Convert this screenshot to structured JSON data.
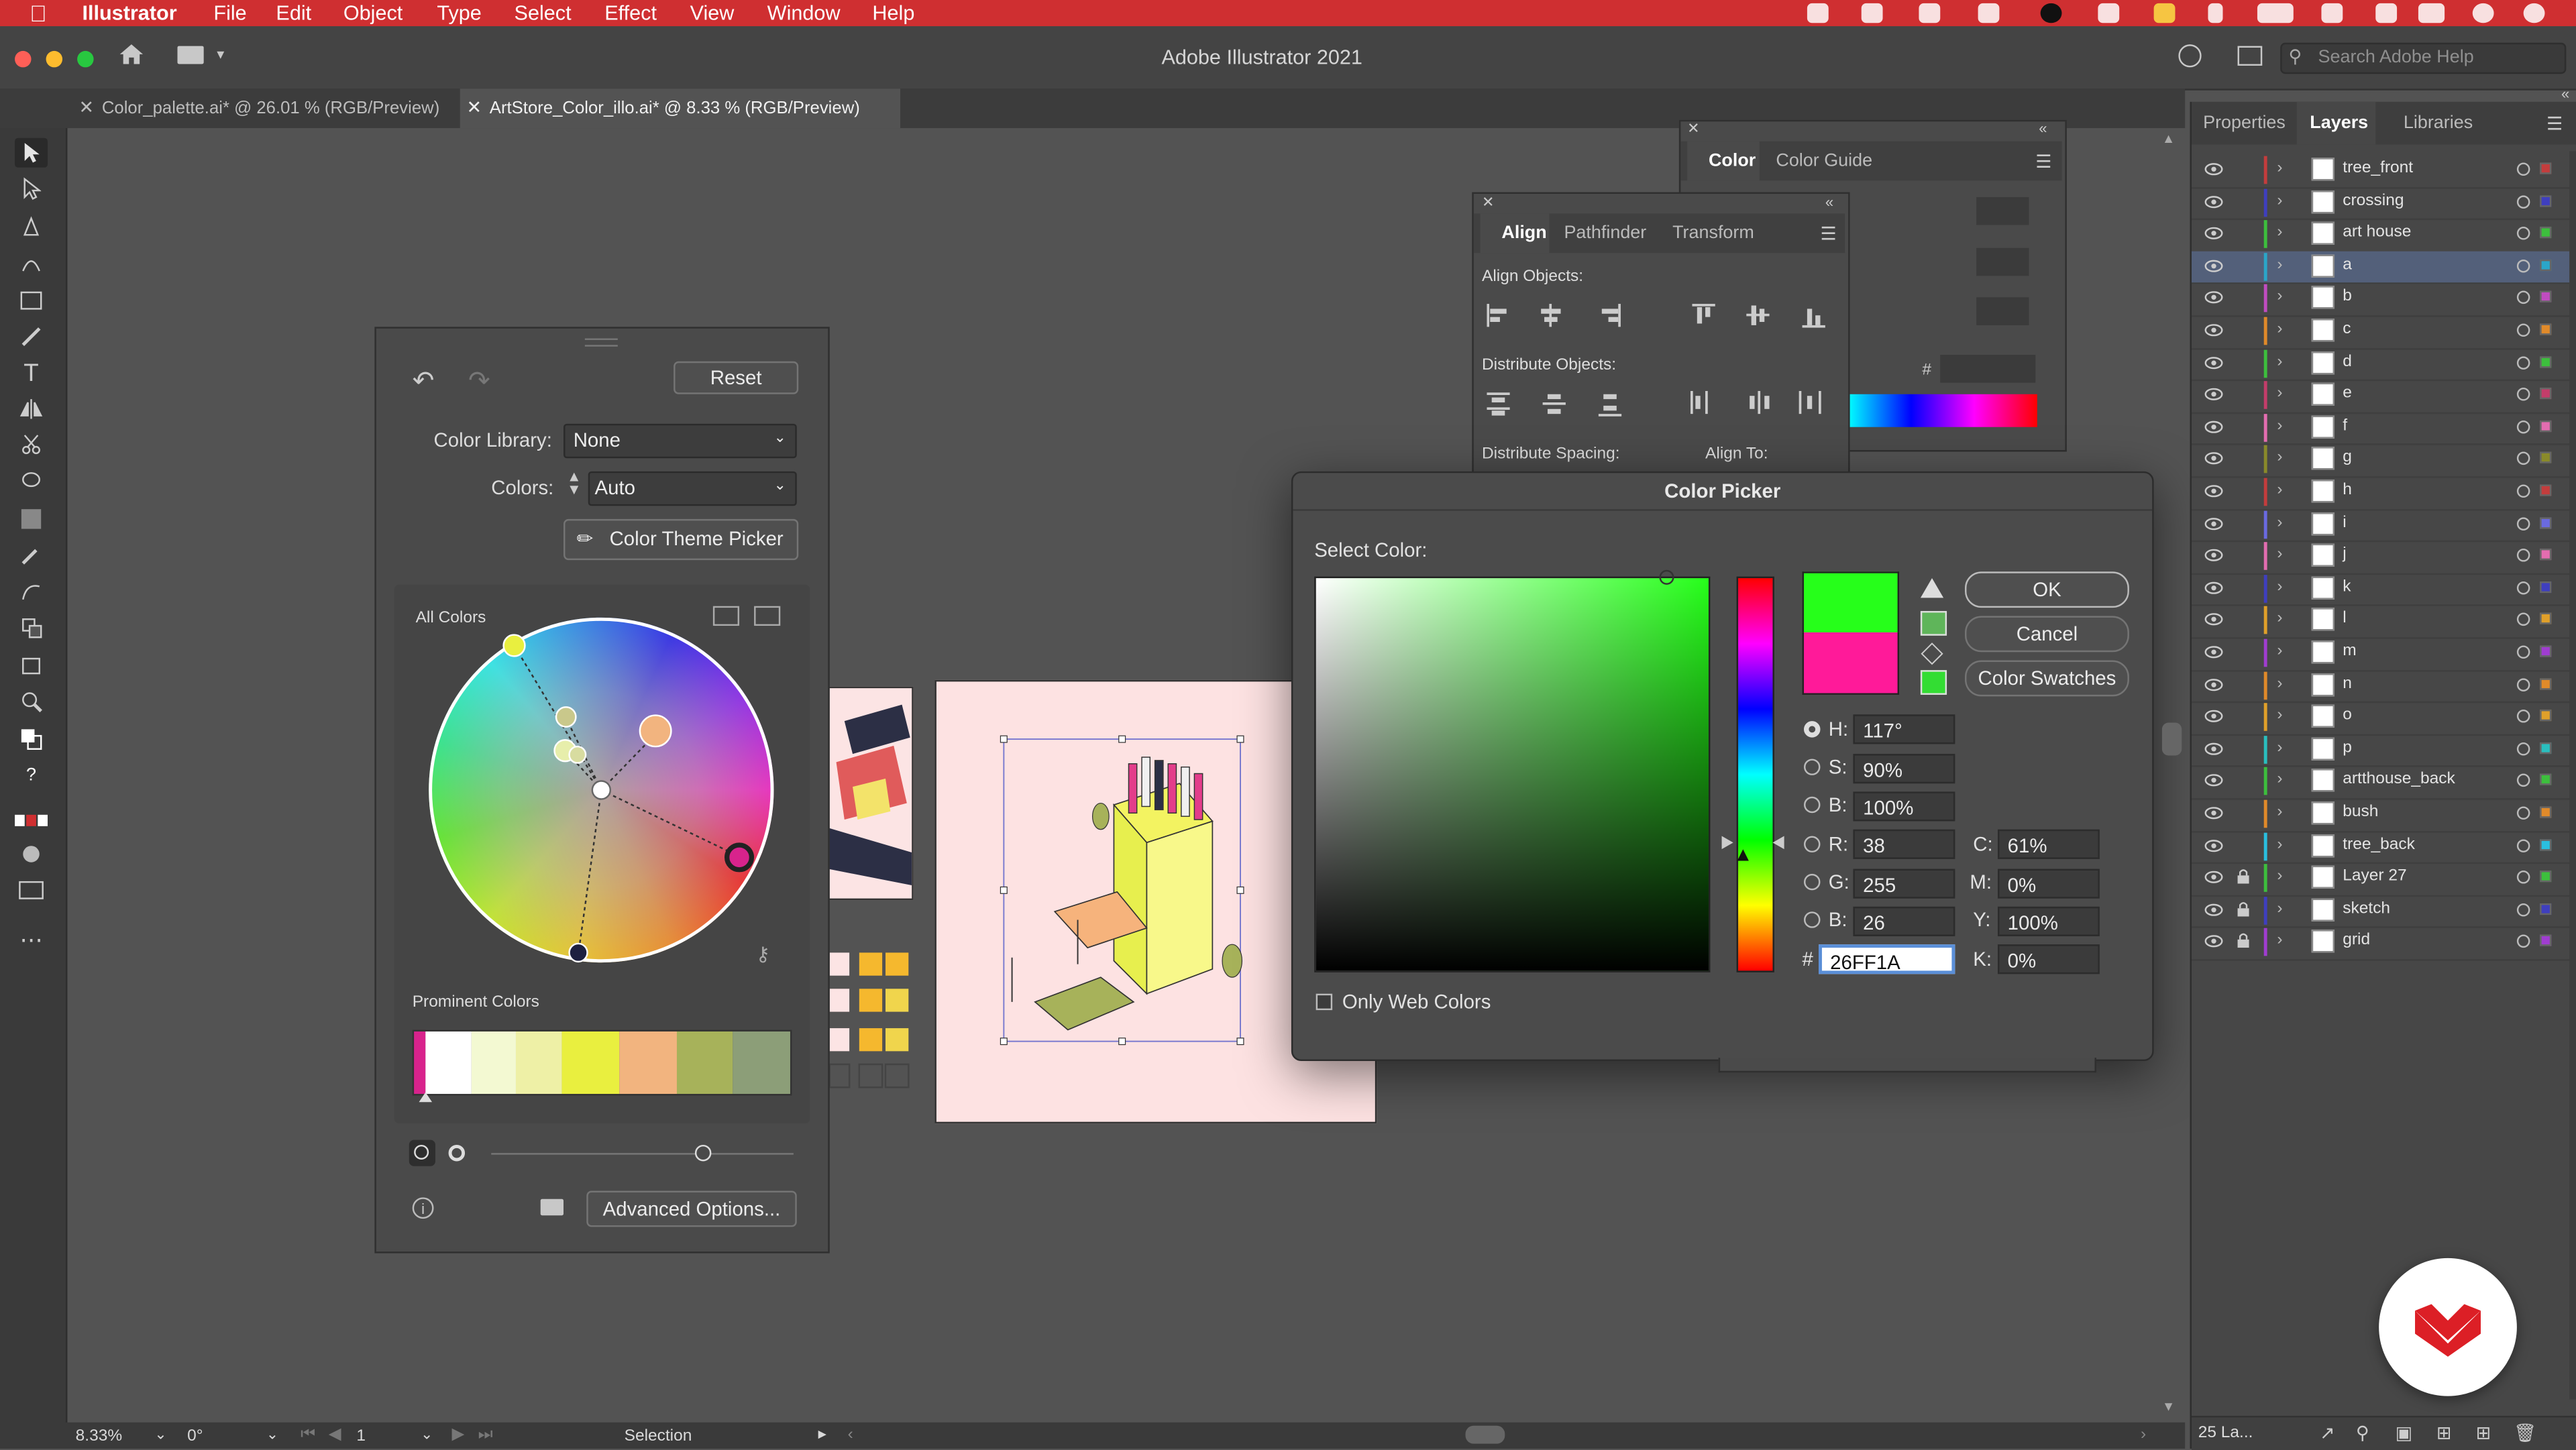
{
  "menubar": {
    "app": "Illustrator",
    "items": [
      "File",
      "Edit",
      "Object",
      "Type",
      "Select",
      "Effect",
      "View",
      "Window",
      "Help"
    ]
  },
  "window": {
    "title": "Adobe Illustrator 2021",
    "search_placeholder": "Search Adobe Help"
  },
  "tabs": [
    {
      "label": "Color_palette.ai* @ 26.01 % (RGB/Preview)",
      "active": false
    },
    {
      "label": "ArtStore_Color_illo.ai* @ 8.33 % (RGB/Preview)",
      "active": true
    }
  ],
  "recolor": {
    "reset": "Reset",
    "color_library_label": "Color Library:",
    "color_library_value": "None",
    "colors_label": "Colors:",
    "colors_value": "Auto",
    "theme_picker": "Color Theme Picker",
    "all_colors": "All Colors",
    "prominent_colors": "Prominent Colors",
    "advanced_options": "Advanced Options...",
    "prominent_swatches": [
      "#d8238c",
      "#ffffff",
      "#f3f9d2",
      "#eef0a6",
      "#e9ef3f",
      "#f2b47f",
      "#a7b25a",
      "#8c9e78"
    ]
  },
  "color_panel": {
    "tabs": [
      "Color",
      "Color Guide"
    ],
    "hash": "#"
  },
  "align_panel": {
    "tabs": [
      "Align",
      "Pathfinder",
      "Transform"
    ],
    "align_objects": "Align Objects:",
    "distribute_objects": "Distribute Objects:",
    "distribute_spacing": "Distribute Spacing:",
    "align_to": "Align To:"
  },
  "color_picker": {
    "title": "Color Picker",
    "select_color": "Select Color:",
    "ok": "OK",
    "cancel": "Cancel",
    "swatches": "Color Swatches",
    "only_web": "Only Web Colors",
    "new_color": "#26ff1a",
    "old_color": "#ff1a99",
    "fields": {
      "H": "117°",
      "S": "90%",
      "B": "100%",
      "R": "38",
      "G": "255",
      "B2": "26",
      "hex": "26FF1A",
      "C": "61%",
      "M": "0%",
      "Y": "100%",
      "K": "0%"
    },
    "field_labels": {
      "H": "H:",
      "S": "S:",
      "B": "B:",
      "R": "R:",
      "G": "G:",
      "B2": "B:",
      "C": "C:",
      "M": "M:",
      "Y": "Y:",
      "K": "K:",
      "hash": "#"
    }
  },
  "layers_panel": {
    "tabs": [
      "Properties",
      "Layers",
      "Libraries"
    ],
    "footer_count": "25 La...",
    "layers": [
      {
        "name": "tree_front",
        "color": "#c33d3d",
        "locked": false
      },
      {
        "name": "crossing",
        "color": "#3f3fbf",
        "locked": false
      },
      {
        "name": "art house",
        "color": "#3dbf3d",
        "locked": false
      },
      {
        "name": "a",
        "color": "#2aa6c8",
        "locked": false,
        "selected": true
      },
      {
        "name": "b",
        "color": "#c04cc0",
        "locked": false
      },
      {
        "name": "c",
        "color": "#e08a2a",
        "locked": false
      },
      {
        "name": "d",
        "color": "#3dbf3d",
        "locked": false
      },
      {
        "name": "e",
        "color": "#c33d6a",
        "locked": false
      },
      {
        "name": "f",
        "color": "#e36db0",
        "locked": false
      },
      {
        "name": "g",
        "color": "#8a8a2a",
        "locked": false
      },
      {
        "name": "h",
        "color": "#c33d3d",
        "locked": false
      },
      {
        "name": "i",
        "color": "#6a6ae0",
        "locked": false
      },
      {
        "name": "j",
        "color": "#e36db0",
        "locked": false
      },
      {
        "name": "k",
        "color": "#3f3fbf",
        "locked": false
      },
      {
        "name": "l",
        "color": "#e0a02a",
        "locked": false
      },
      {
        "name": "m",
        "color": "#a03dd0",
        "locked": false
      },
      {
        "name": "n",
        "color": "#e08a2a",
        "locked": false
      },
      {
        "name": "o",
        "color": "#e0a02a",
        "locked": false
      },
      {
        "name": "p",
        "color": "#2abfbf",
        "locked": false
      },
      {
        "name": "artthouse_back",
        "color": "#3dbf3d",
        "locked": false
      },
      {
        "name": "bush",
        "color": "#e08a2a",
        "locked": false
      },
      {
        "name": "tree_back",
        "color": "#2abfdf",
        "locked": false
      },
      {
        "name": "Layer 27",
        "color": "#3dbf3d",
        "locked": true
      },
      {
        "name": "sketch",
        "color": "#3f3fbf",
        "locked": true
      },
      {
        "name": "grid",
        "color": "#a03dd0",
        "locked": true
      }
    ]
  },
  "status": {
    "zoom": "8.33%",
    "rotation": "0°",
    "page": "1",
    "tool": "Selection"
  }
}
